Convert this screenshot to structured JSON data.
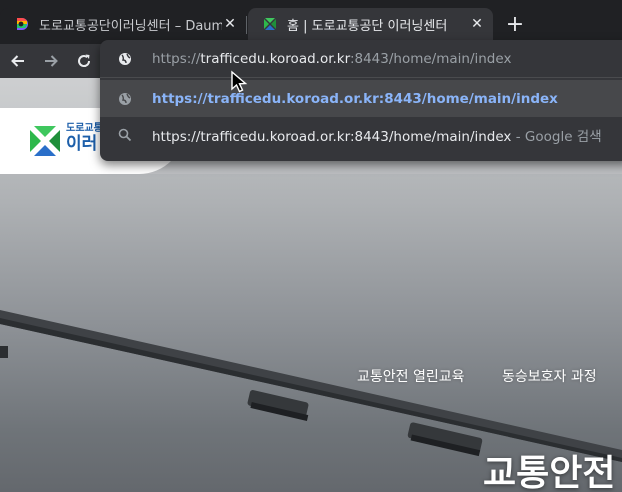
{
  "browser": {
    "tabs": [
      {
        "title": "도로교통공단이러닝센터 – Daum",
        "state": "inactive"
      },
      {
        "title": "홈 | 도로교통공단 이러닝센터",
        "state": "active"
      }
    ],
    "close_glyph": "✕",
    "new_tab_glyph": "+",
    "accent_colors": {
      "tab_active": "#35363a",
      "frame": "#202124",
      "link": "#8ab4f8"
    }
  },
  "omnibox": {
    "input": {
      "scheme": "https://",
      "host": "trafficedu.koroad.or.kr",
      "rest": ":8443/home/main/index"
    },
    "suggestions": [
      {
        "icon": "globe-icon",
        "text": "https://trafficedu.koroad.or.kr:8443/home/main/index",
        "suffix": ""
      },
      {
        "icon": "search-icon",
        "text": "https://trafficedu.koroad.or.kr:8443/home/main/index",
        "suffix": " - Google 검색"
      }
    ]
  },
  "site": {
    "logo_small": "도로교통",
    "logo_large": "이러",
    "gnb": [
      {
        "label": "교통안전 열린교육"
      },
      {
        "label": "동승보호자 과정"
      }
    ],
    "hero_title": "교통안전"
  }
}
